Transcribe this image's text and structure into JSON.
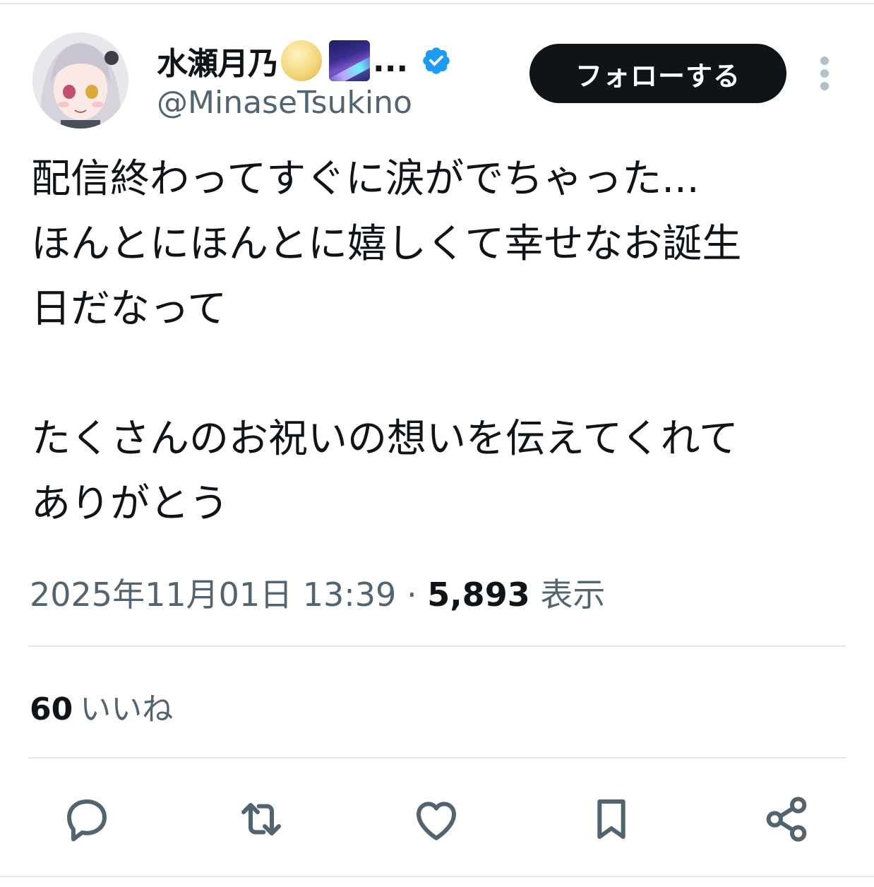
{
  "author": {
    "display_name": "水瀬月乃",
    "name_truncation": "...",
    "handle": "@MinaseTsukino",
    "emoji_icons": [
      "full-moon-emoji",
      "milky-way-emoji"
    ],
    "verified_badge_color": "#1d9bf0"
  },
  "follow_button": {
    "label": "フォローする"
  },
  "tweet": {
    "lines": [
      "配信終わってすぐに涙がでちゃった...",
      "ほんとにほんとに嬉しくて幸せなお誕生",
      "日だなって",
      "",
      "たくさんのお祝いの想いを伝えてくれて",
      "ありがとう"
    ]
  },
  "meta": {
    "timestamp": "2025年11月01日 13:39",
    "separator": "·",
    "views_count": "5,893",
    "views_label": "表示"
  },
  "engagement": {
    "likes_count": "60",
    "likes_label": "いいね"
  },
  "actions": [
    "reply-icon",
    "retweet-icon",
    "like-icon",
    "bookmark-icon",
    "share-icon"
  ],
  "colors": {
    "text_primary": "#0f1419",
    "text_secondary": "#536471",
    "button_bg": "#0f1419",
    "divider": "#e3e6e8"
  }
}
